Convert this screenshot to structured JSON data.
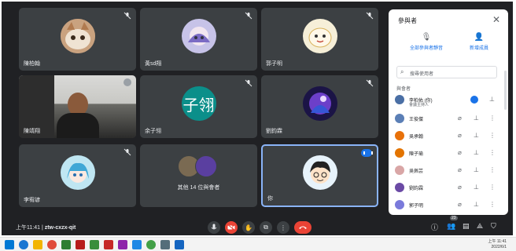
{
  "meeting": {
    "code": "ztw-cxzx-qit",
    "time": "上午11:41",
    "tiles": [
      {
        "name": "陳柏翰",
        "muted": true,
        "avatar": "cat-photo"
      },
      {
        "name": "黃sd翔",
        "muted": true,
        "avatar": "anime-girl"
      },
      {
        "name": "郭子明",
        "muted": true,
        "avatar": "cartoon-character"
      },
      {
        "name": "陳靖翔",
        "muted": false,
        "avatar": "camera-feed"
      },
      {
        "name": "余子翎",
        "muted": true,
        "avatar_letter": "子翎"
      },
      {
        "name": "劉鈞霖",
        "muted": true,
        "avatar": "purple-anime"
      },
      {
        "name": "李宥諺",
        "muted": true,
        "avatar": "blue-anime"
      },
      {
        "name": "其他 14 位與會者",
        "muted": false,
        "avatar": "group"
      },
      {
        "name": "你",
        "muted": false,
        "avatar": "cartoon-boy",
        "speaking": true
      }
    ]
  },
  "controls": {
    "mic": "mic-icon",
    "cam": "cam-off-icon",
    "hand": "raise-hand-icon",
    "present": "present-icon",
    "more": "more-icon",
    "leave": "leave-call-icon",
    "people_count": "23"
  },
  "panel": {
    "title": "參與者",
    "btn_mute_all": "全部參與者靜音",
    "btn_add": "新增成員",
    "search_placeholder": "搜尋使用者",
    "section": "與會者",
    "participants": [
      {
        "name": "李柏佑 (你)",
        "sub": "會議主持人",
        "color": "#4a6fa5",
        "speaking": true
      },
      {
        "name": "王俊傑",
        "color": "#5b7fb6"
      },
      {
        "name": "吳承翰",
        "color": "#e8710a"
      },
      {
        "name": "陳子瑜",
        "color": "#e37400"
      },
      {
        "name": "吳佩芸",
        "color": "#d9a6a6"
      },
      {
        "name": "劉鈞霖",
        "color": "#6b4aa5"
      },
      {
        "name": "郭子明",
        "color": "#7a7adb"
      }
    ]
  },
  "taskbar": {
    "time": "上午 11:41",
    "date": "2022/6/1"
  }
}
